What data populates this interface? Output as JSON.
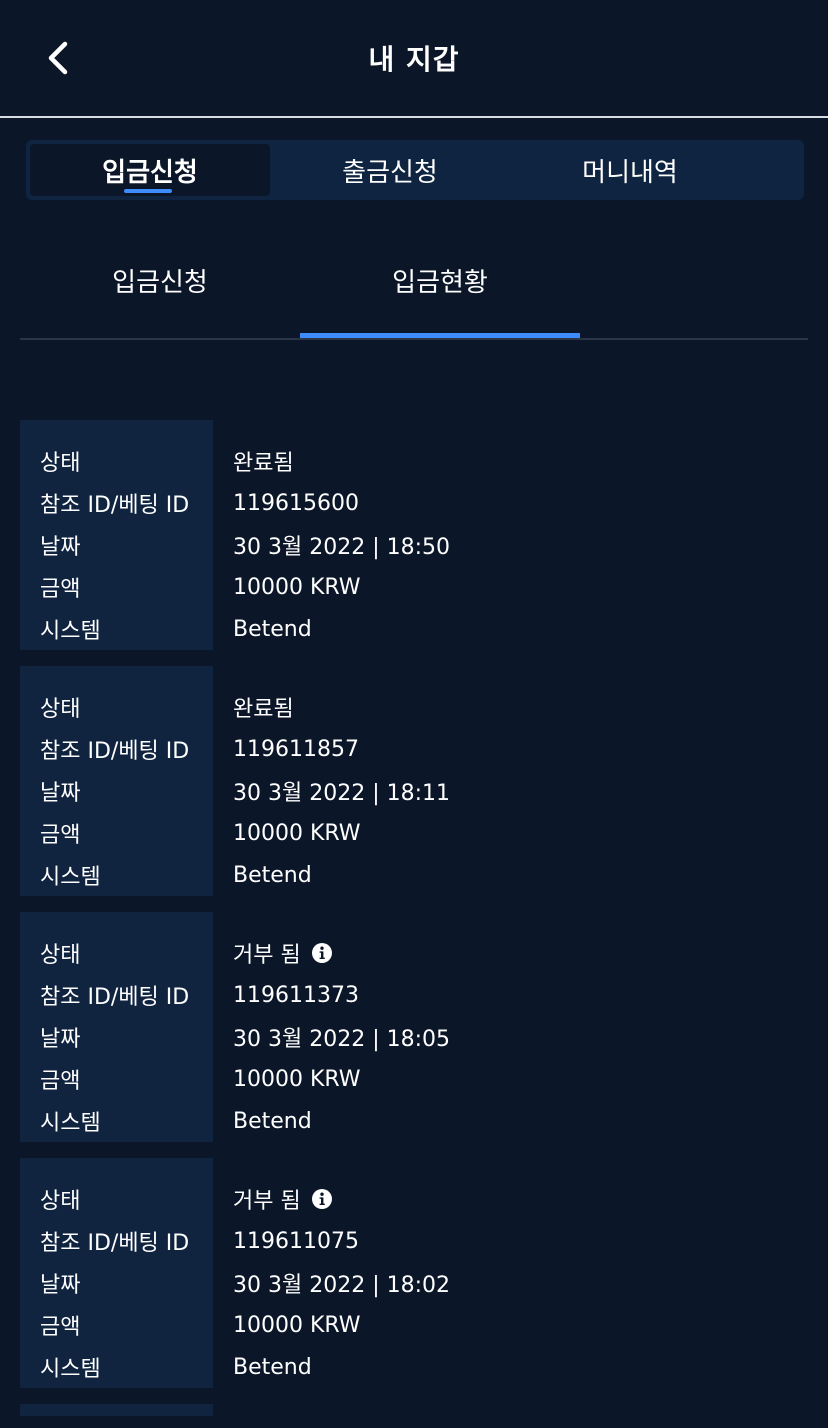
{
  "header": {
    "title": "내 지갑",
    "back_icon": "chevron-left-icon"
  },
  "main_tabs": [
    {
      "label": "입금신청",
      "active": true
    },
    {
      "label": "출금신청",
      "active": false
    },
    {
      "label": "머니내역",
      "active": false
    }
  ],
  "sub_tabs": [
    {
      "label": "입금신청",
      "active": false
    },
    {
      "label": "입금현황",
      "active": true
    }
  ],
  "labels": {
    "status": "상태",
    "ref_id": "참조 ID/베팅 ID",
    "date": "날짜",
    "amount": "금액",
    "system": "시스템"
  },
  "records": [
    {
      "status": "완료됨",
      "has_info": false,
      "ref_id": "119615600",
      "date": "30 3월 2022 | 18:50",
      "amount": "10000 KRW",
      "system": "Betend"
    },
    {
      "status": "완료됨",
      "has_info": false,
      "ref_id": "119611857",
      "date": "30 3월 2022 | 18:11",
      "amount": "10000 KRW",
      "system": "Betend"
    },
    {
      "status": "거부 됨",
      "has_info": true,
      "ref_id": "119611373",
      "date": "30 3월 2022 | 18:05",
      "amount": "10000 KRW",
      "system": "Betend"
    },
    {
      "status": "거부 됨",
      "has_info": true,
      "ref_id": "119611075",
      "date": "30 3월 2022 | 18:02",
      "amount": "10000 KRW",
      "system": "Betend"
    }
  ],
  "colors": {
    "background": "#0b1628",
    "panel": "#102440",
    "accent": "#3d8bfd"
  }
}
